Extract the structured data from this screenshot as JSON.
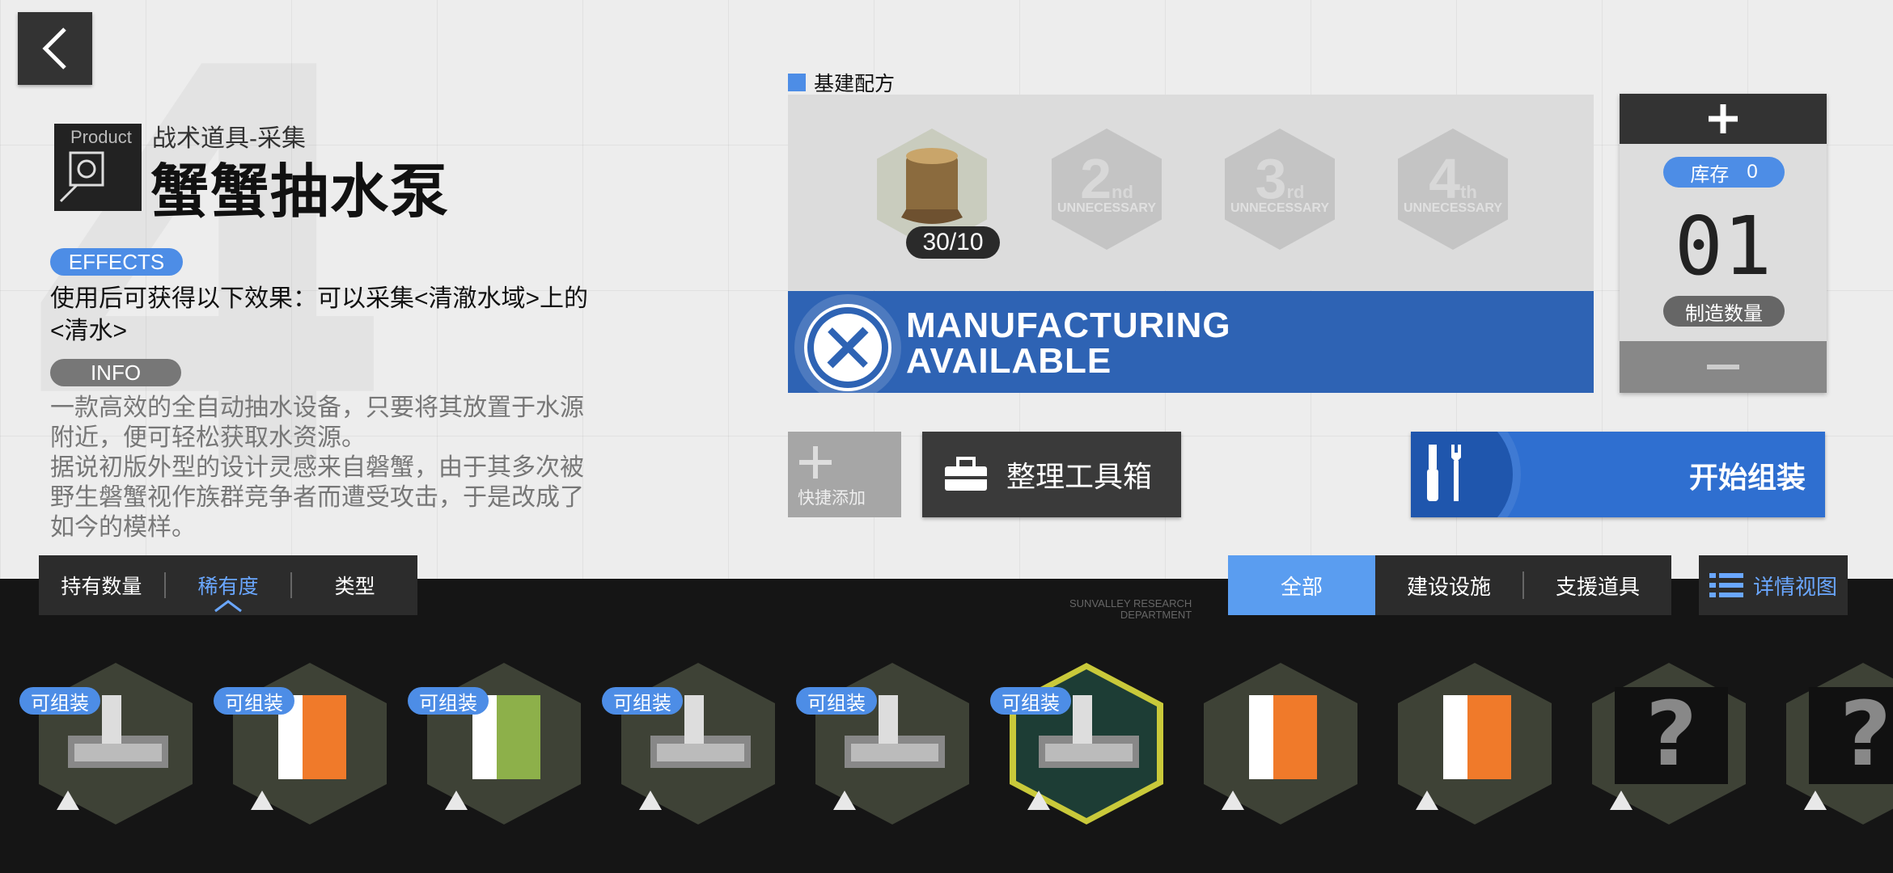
{
  "item": {
    "product_label": "Product",
    "category": "战术道具-采集",
    "name": "蟹蟹抽水泵",
    "effects_label": "EFFECTS",
    "effect_text": "使用后可获得以下效果：可以采集<清澈水域>上的<清水>",
    "info_label": "INFO",
    "info_lines": [
      "一款高效的全自动抽水设备，只要将其放置于水源",
      "附近，便可轻松获取水资源。",
      "据说初版外型的设计灵感来自磐蟹，由于其多次被",
      "野生磐蟹视作族群竞争者而遭受攻击，于是改成了",
      "如今的模样。"
    ]
  },
  "sort": {
    "owned": "持有数量",
    "rarity": "稀有度",
    "type": "类型"
  },
  "recipe": {
    "label": "基建配方",
    "materials": [
      {
        "qty": "30/10"
      },
      {
        "ordinal": "2",
        "suffix": "nd",
        "note": "UNNECESSARY"
      },
      {
        "ordinal": "3",
        "suffix": "rd",
        "note": "UNNECESSARY"
      },
      {
        "ordinal": "4",
        "suffix": "th",
        "note": "UNNECESSARY"
      }
    ],
    "status_line1": "MANUFACTURING",
    "status_line2": "AVAILABLE"
  },
  "counter": {
    "stock_label": "库存",
    "stock_value": "0",
    "count": "01",
    "count_label": "制造数量"
  },
  "actions": {
    "quick_add": "快捷添加",
    "toolbox": "整理工具箱",
    "start": "开始组装"
  },
  "filters": {
    "all": "全部",
    "build": "建设设施",
    "support": "支援道具",
    "detail": "详情视图"
  },
  "sunvalley": [
    "SUNVALLEY RESEARCH",
    "DEPARTMENT"
  ],
  "cards": [
    {
      "tag": "可组装"
    },
    {
      "tag": "可组装"
    },
    {
      "tag": "可组装"
    },
    {
      "tag": "可组装"
    },
    {
      "tag": "可组装"
    },
    {
      "tag": "可组装",
      "selected": true
    },
    {
      "tag": ""
    },
    {
      "tag": ""
    },
    {
      "tag": ""
    },
    {
      "tag": ""
    }
  ],
  "colors": {
    "accent": "#4d8de6",
    "banner": "#2e63b4",
    "select": "#c9c93a"
  }
}
